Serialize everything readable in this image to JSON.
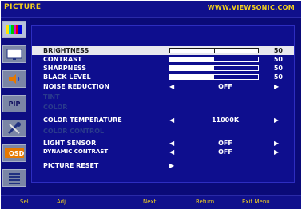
{
  "header": {
    "title": "PICTURE",
    "url": "WWW.VIEWSONIC.COM"
  },
  "sidebar": {
    "tabs": [
      {
        "icon": "color-bars-icon"
      },
      {
        "icon": "monitor-icon"
      },
      {
        "icon": "speaker-icon"
      },
      {
        "icon": "pip-icon",
        "label": "PIP"
      },
      {
        "icon": "tools-icon"
      },
      {
        "icon": "osd-icon",
        "label": "OSD"
      },
      {
        "icon": "menu-list-icon"
      }
    ]
  },
  "menu": {
    "items": [
      {
        "label": "BRIGHTNESS",
        "type": "slider",
        "value": "50",
        "level": 0.5,
        "selected": true
      },
      {
        "label": "CONTRAST",
        "type": "slider",
        "value": "50",
        "level": 0.5
      },
      {
        "label": "SHARPNESS",
        "type": "slider",
        "value": "50",
        "level": 0.5
      },
      {
        "label": "BLACK LEVEL",
        "type": "slider",
        "value": "50",
        "level": 0.5
      },
      {
        "label": "NOISE REDUCTION",
        "type": "option",
        "value": "OFF"
      },
      {
        "label": "TINT",
        "type": "disabled"
      },
      {
        "label": "COLOR",
        "type": "disabled"
      },
      {
        "label": "COLOR TEMPERATURE",
        "type": "option",
        "value": "11000K"
      },
      {
        "label": "COLOR CONTROL",
        "type": "disabled"
      },
      {
        "label": "LIGHT SENSOR",
        "type": "option",
        "value": "OFF"
      },
      {
        "label": "DYNAMIC CONTRAST",
        "type": "option",
        "value": "OFF"
      },
      {
        "label": "PICTURE RESET",
        "type": "action"
      }
    ]
  },
  "footer": {
    "hints": [
      "Sel",
      "Adj",
      "Next",
      "Return",
      "Exit Menu"
    ]
  },
  "colors": {
    "background": "#0a0a78",
    "accent": "#f4d21c",
    "highlight": "#e8e8ee"
  }
}
